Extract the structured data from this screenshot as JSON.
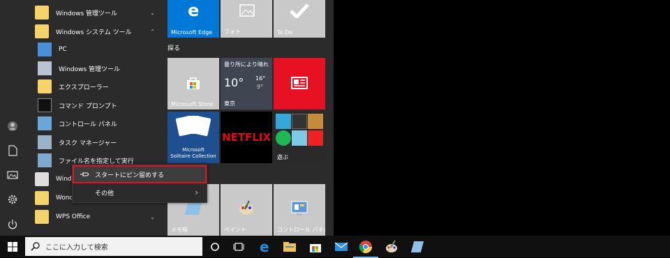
{
  "applist": {
    "items": [
      {
        "label": "Windows 管理ツール",
        "chevron": "⌄"
      },
      {
        "label": "Windows システム ツール",
        "chevron": "⌃"
      },
      {
        "label": "PC"
      },
      {
        "label": "Windows 管理ツール"
      },
      {
        "label": "エクスプローラー"
      },
      {
        "label": "コマンド プロンプト"
      },
      {
        "label": "コントロール パネル"
      },
      {
        "label": "タスク マネージャー"
      },
      {
        "label": "ファイル名を指定して実行"
      },
      {
        "label": "Window"
      },
      {
        "label": "Wonde"
      },
      {
        "label": "WPS Office",
        "chevron": "⌄"
      }
    ]
  },
  "tiles": {
    "edge": "Microsoft Edge",
    "photos": "フォト",
    "todo": "To Do",
    "group_explore": "探る",
    "store": "Microsoft Store",
    "weather": {
      "cond": "曇り所により晴れ",
      "temp": "10°",
      "high": "16°",
      "low": "9°",
      "city": "東京"
    },
    "news": "",
    "solitaire_line1": "Microsoft",
    "solitaire_line2": "Solitaire Collection",
    "netflix": "NETFLIX",
    "play": "遊ぶ",
    "memo": "メモ帳",
    "paint": "ペイント",
    "control": "コントロール パネル"
  },
  "context_menu": {
    "pin": "スタートにピン留めする",
    "more": "その他",
    "more_chevron": "›"
  },
  "taskbar": {
    "search_placeholder": "ここに入力して検索"
  },
  "colors": {
    "accent": "#0078d7",
    "highlight": "#e81123",
    "tile_gray": "#c9c9c9",
    "news_red": "#e81123"
  }
}
